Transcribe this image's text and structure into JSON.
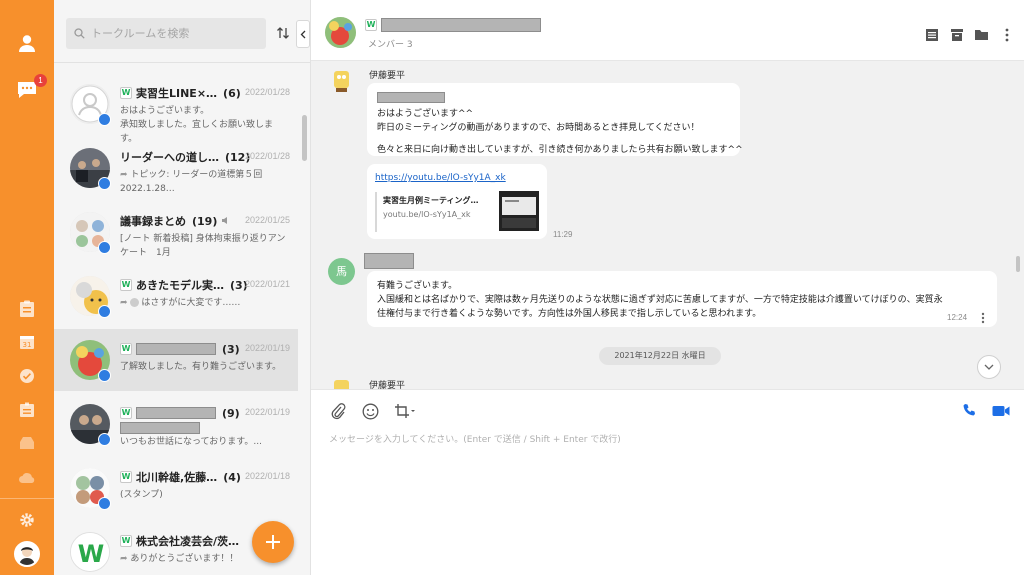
{
  "rail": {
    "notification_count": "1"
  },
  "search": {
    "placeholder": "トークルームを検索"
  },
  "rooms": [
    {
      "name": "実習生LINE×…",
      "count": "(6)",
      "date": "2022/01/28",
      "preview_line1": "おはようございます。",
      "preview_line2": "承知致しました。宜しくお願い致します。",
      "has_w": true
    },
    {
      "name": "リーダーへの道し…",
      "count": "(12)",
      "date": "2022/01/28",
      "preview_line1": "トピック: リーダーの道標第５回",
      "preview_line2": "2022.1.28…",
      "has_w": false
    },
    {
      "name": "議事録まとめ",
      "count": "(19)",
      "date": "2022/01/25",
      "preview_line1": "[ノート 新着投稿] 身体拘束振り返りアン",
      "preview_line2": "ケート　1月",
      "has_w": false
    },
    {
      "name": "あきたモデル実…",
      "count": "(3)",
      "date": "2022/01/21",
      "preview_line1": "はさすがに大変です……",
      "preview_line2": "",
      "has_w": true
    },
    {
      "name": "",
      "count": "(3)",
      "date": "2022/01/19",
      "preview_line1": "了解致しました。有り難うございます。",
      "preview_line2": "",
      "has_w": true
    },
    {
      "name": "",
      "count": "(9)",
      "date": "2022/01/19",
      "preview_line1": "いつもお世話になっております。...",
      "preview_line2": "",
      "has_w": true
    },
    {
      "name": "北川幹雄,佐藤…",
      "count": "(4)",
      "date": "2022/01/18",
      "preview_line1": "(スタンプ)",
      "preview_line2": "",
      "has_w": true
    },
    {
      "name": "株式会社凌芸会/茨…",
      "count": "",
      "date": "",
      "preview_line1": "ありがとうございます！！",
      "preview_line2": "",
      "has_w": true
    }
  ],
  "header": {
    "members": "メンバー 3"
  },
  "messages": {
    "sender1": "伊藤要平",
    "msg1_lines": [
      "おはようございます^^",
      "昨日のミーティングの動画がありますので、お時間あるとき拝見してください！",
      "",
      "色々と来日に向け動き出していますが、引き続き何かありましたら共有お願い致します^^"
    ],
    "link_url": "https://youtu.be/lO-sYy1A_xk",
    "link_title": "実習生月例ミーティング…",
    "link_domain": "youtu.be/lO-sYy1A_xk",
    "time1": "11:29",
    "sender2_avatar": "馬",
    "msg2_lines": [
      "有難うございます。",
      "入国緩和とは名ばかりで、実際は数ヶ月先送りのような状態に過ぎず対応に苦慮してますが、一方で特定技能は介護置いてけぼりの、実質永",
      "住権付与まで行き着くような勢いです。方向性は外国人移民まで指し示していると思われます。"
    ],
    "time2": "12:24",
    "date_chip": "2021年12月22日 水曜日",
    "sender3": "伊藤要平"
  },
  "composer": {
    "placeholder": "メッセージを入力してください。(Enter で送信 / Shift + Enter で改行)"
  },
  "colors": {
    "brand_orange": "#f7902c",
    "link_blue": "#1b64c8",
    "call_blue": "#1d6ee6",
    "badge_red": "#e8413b"
  }
}
